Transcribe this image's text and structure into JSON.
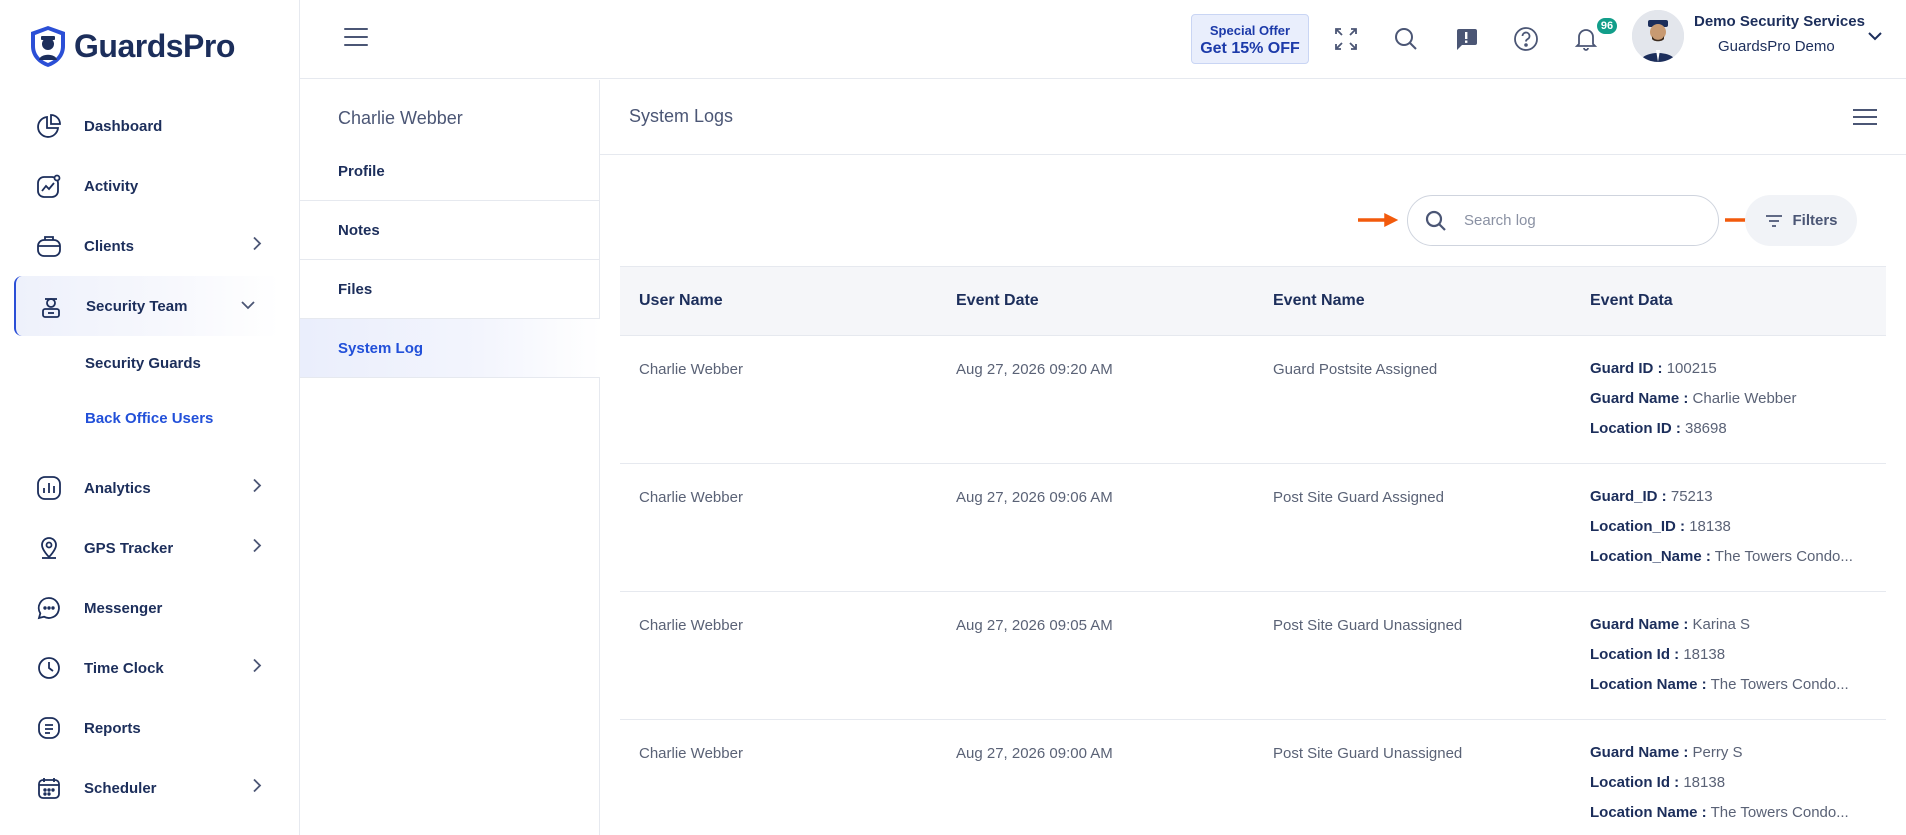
{
  "brand": {
    "name": "GuardsPro"
  },
  "sidebar": {
    "items": [
      {
        "label": "Dashboard",
        "icon": "pie-chart-icon",
        "has_chevron": false
      },
      {
        "label": "Activity",
        "icon": "activity-chart-icon",
        "has_chevron": false
      },
      {
        "label": "Clients",
        "icon": "briefcase-icon",
        "has_chevron": true
      },
      {
        "label": "Security Team",
        "icon": "guard-icon",
        "has_chevron": true,
        "expanded": true
      },
      {
        "label": "Analytics",
        "icon": "bar-chart-icon",
        "has_chevron": true
      },
      {
        "label": "GPS Tracker",
        "icon": "map-pin-icon",
        "has_chevron": true
      },
      {
        "label": "Messenger",
        "icon": "chat-icon",
        "has_chevron": false
      },
      {
        "label": "Time Clock",
        "icon": "clock-icon",
        "has_chevron": true
      },
      {
        "label": "Reports",
        "icon": "document-icon",
        "has_chevron": false
      },
      {
        "label": "Scheduler",
        "icon": "calendar-icon",
        "has_chevron": true
      }
    ],
    "security_team_sub": [
      {
        "label": "Security Guards",
        "selected": false
      },
      {
        "label": "Back Office Users",
        "selected": true
      }
    ]
  },
  "header": {
    "offer_line1": "Special Offer",
    "offer_line2": "Get 15% OFF",
    "notification_count": "96",
    "user_name": "Demo Security Services",
    "user_org": "GuardsPro Demo"
  },
  "profile_panel": {
    "person": "Charlie Webber",
    "menu": [
      {
        "label": "Profile",
        "active": false
      },
      {
        "label": "Notes",
        "active": false
      },
      {
        "label": "Files",
        "active": false
      },
      {
        "label": "System Log",
        "active": true
      }
    ]
  },
  "main": {
    "title": "System Logs",
    "search_placeholder": "Search log",
    "filters_label": "Filters",
    "columns": [
      "User Name",
      "Event Date",
      "Event Name",
      "Event Data"
    ],
    "rows": [
      {
        "user": "Charlie Webber",
        "date": "Aug 27, 2026 09:20 AM",
        "event": "Guard Postsite Assigned",
        "data": [
          {
            "k": "Guard ID :",
            "v": "100215"
          },
          {
            "k": "Guard Name :",
            "v": "Charlie Webber"
          },
          {
            "k": "Location ID :",
            "v": "38698"
          }
        ]
      },
      {
        "user": "Charlie Webber",
        "date": "Aug 27, 2026 09:06 AM",
        "event": "Post Site Guard Assigned",
        "data": [
          {
            "k": "Guard_ID :",
            "v": "75213"
          },
          {
            "k": "Location_ID :",
            "v": "18138"
          },
          {
            "k": "Location_Name :",
            "v": "The Towers Condo..."
          }
        ]
      },
      {
        "user": "Charlie Webber",
        "date": "Aug 27, 2026 09:05 AM",
        "event": "Post Site Guard Unassigned",
        "data": [
          {
            "k": "Guard Name :",
            "v": "Karina S"
          },
          {
            "k": "Location Id :",
            "v": "18138"
          },
          {
            "k": "Location Name :",
            "v": "The Towers Condo..."
          }
        ]
      },
      {
        "user": "Charlie Webber",
        "date": "Aug 27, 2026 09:00 AM",
        "event": "Post Site Guard Unassigned",
        "data": [
          {
            "k": "Guard Name :",
            "v": "Perry S"
          },
          {
            "k": "Location Id :",
            "v": "18138"
          },
          {
            "k": "Location Name :",
            "v": "The Towers Condo..."
          }
        ]
      }
    ]
  },
  "colors": {
    "accent": "#2250d9",
    "navy": "#1c2e5b",
    "arrow": "#f25a0c",
    "badge": "#129e8a"
  }
}
